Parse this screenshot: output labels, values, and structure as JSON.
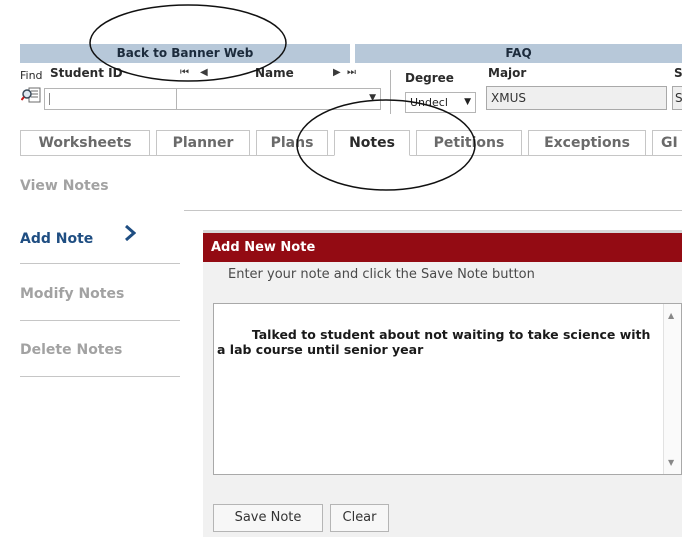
{
  "header_links": {
    "back": "Back to Banner Web",
    "faq": "FAQ"
  },
  "search": {
    "find_label": "Find",
    "student_id_label": "Student ID",
    "student_id_value": "",
    "name_label": "Name",
    "name_value": "",
    "nav_first": "⏮",
    "nav_prev": "◀",
    "nav_next": "▶",
    "nav_last": "⏭",
    "degree_label": "Degree",
    "degree_value": "Undecl",
    "major_label": "Major",
    "major_value": "XMUS",
    "s_label": "S",
    "s_value": "S"
  },
  "tabs": [
    {
      "label": "Worksheets"
    },
    {
      "label": "Planner"
    },
    {
      "label": "Plans"
    },
    {
      "label": "Notes",
      "active": true
    },
    {
      "label": "Petitions"
    },
    {
      "label": "Exceptions"
    },
    {
      "label": "GI"
    }
  ],
  "side_menu": {
    "items": [
      {
        "label": "View Notes"
      },
      {
        "label": "Add Note",
        "active": true
      },
      {
        "label": "Modify Notes"
      },
      {
        "label": "Delete Notes"
      }
    ]
  },
  "panel": {
    "title": "Add New Note",
    "instruction": "Enter your note and click the Save Note button",
    "note_text": "Talked to student about not waiting to take science with a lab course until senior year",
    "save_label": "Save Note",
    "clear_label": "Clear"
  },
  "colors": {
    "top_bar": "#b7c8d9",
    "panel_header": "#930b13",
    "active_side": "#1f4e82"
  },
  "icons": [
    "find-icon",
    "chevron-right-icon",
    "scroll-up-icon",
    "scroll-down-icon"
  ]
}
